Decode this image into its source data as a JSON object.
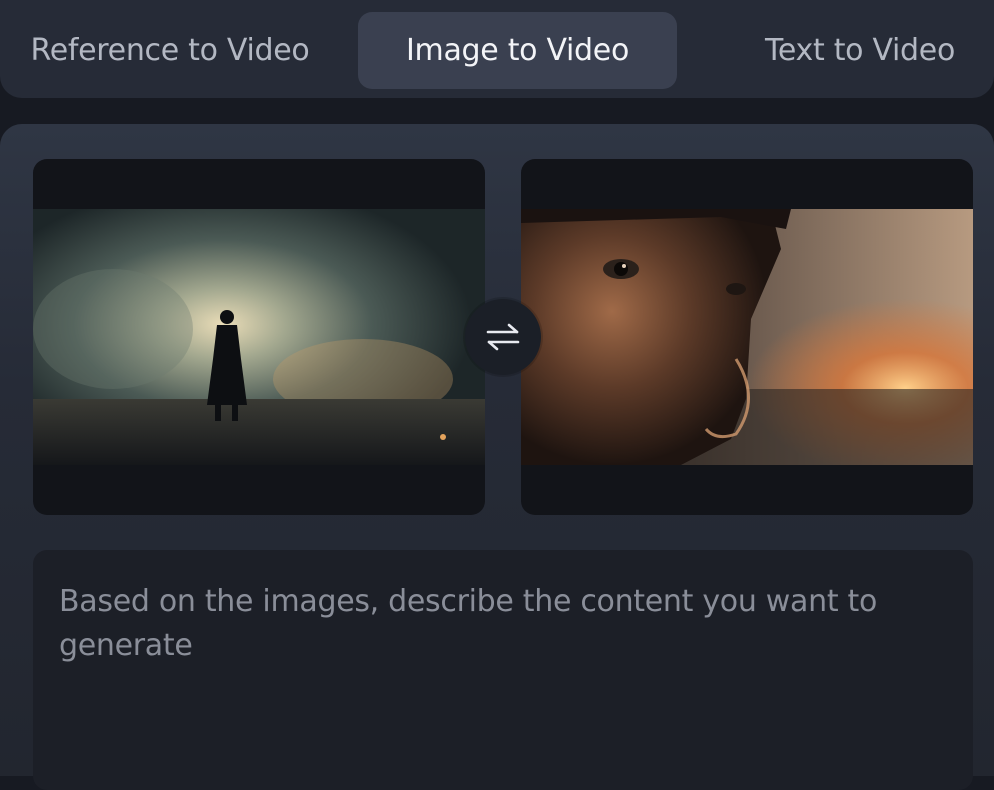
{
  "tabs": [
    {
      "label": "Reference to Video",
      "active": false
    },
    {
      "label": "Image to Video",
      "active": true
    },
    {
      "label": "Text to Video",
      "active": false
    }
  ],
  "images": [
    {
      "description_icon": "image-thumbnail",
      "slot": "first-frame"
    },
    {
      "description_icon": "image-thumbnail",
      "slot": "last-frame"
    }
  ],
  "swap": {
    "icon": "swap-arrows-icon"
  },
  "prompt": {
    "placeholder": "Based on the images, describe the content you want to generate",
    "value": ""
  },
  "colors": {
    "background": "#171a22",
    "tabbar": "#262b37",
    "active_tab": "#3a4050",
    "panel": "#262b37"
  }
}
